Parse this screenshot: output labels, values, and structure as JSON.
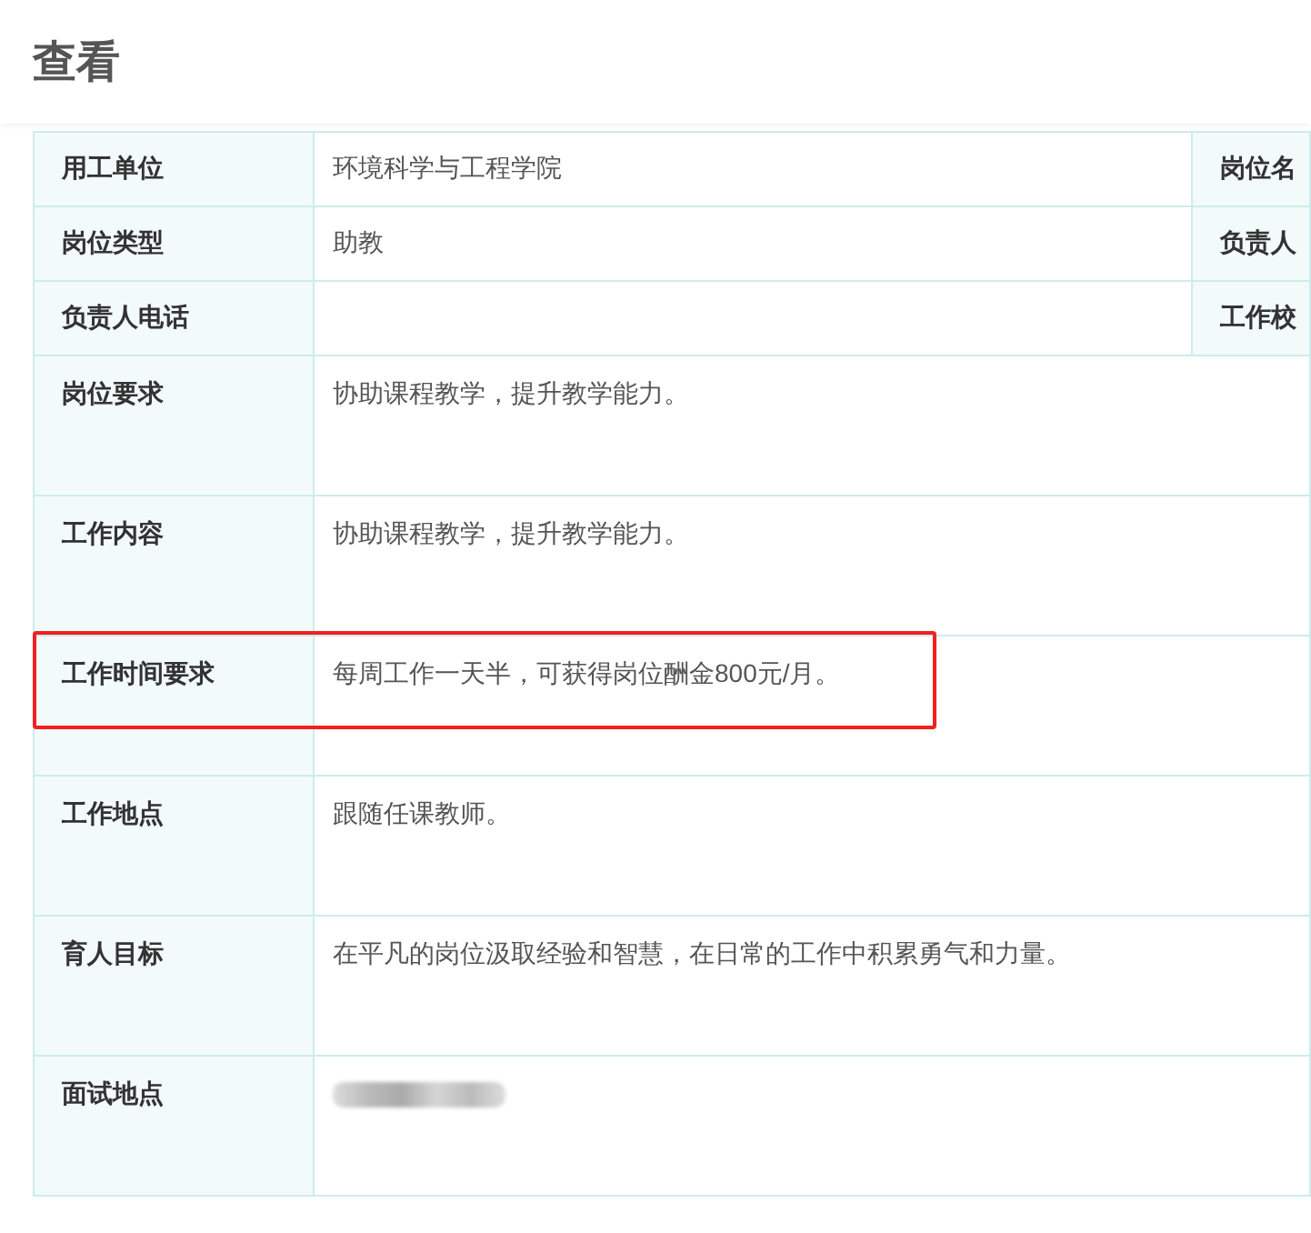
{
  "page_title": "查看",
  "short_rows": [
    {
      "label": "用工单位",
      "value": "环境科学与工程学院",
      "label_2": "岗位名"
    },
    {
      "label": "岗位类型",
      "value": "助教",
      "label_2": "负责人"
    },
    {
      "label": "负责人电话",
      "value": "",
      "label_2": "工作校"
    }
  ],
  "long_rows": [
    {
      "kind": "text",
      "label": "岗位要求",
      "value": "协助课程教学，提升教学能力。",
      "highlighted": false
    },
    {
      "kind": "text",
      "label": "工作内容",
      "value": "协助课程教学，提升教学能力。",
      "highlighted": false
    },
    {
      "kind": "text",
      "label": "工作时间要求",
      "value": "每周工作一天半，可获得岗位酬金800元/月。",
      "highlighted": true
    },
    {
      "kind": "text",
      "label": "工作地点",
      "value": "跟随任课教师。",
      "highlighted": false
    },
    {
      "kind": "text",
      "label": "育人目标",
      "value": "在平凡的岗位汲取经验和智慧，在日常的工作中积累勇气和力量。",
      "highlighted": false
    },
    {
      "kind": "redacted",
      "label": "面试地点",
      "highlighted": false
    }
  ]
}
